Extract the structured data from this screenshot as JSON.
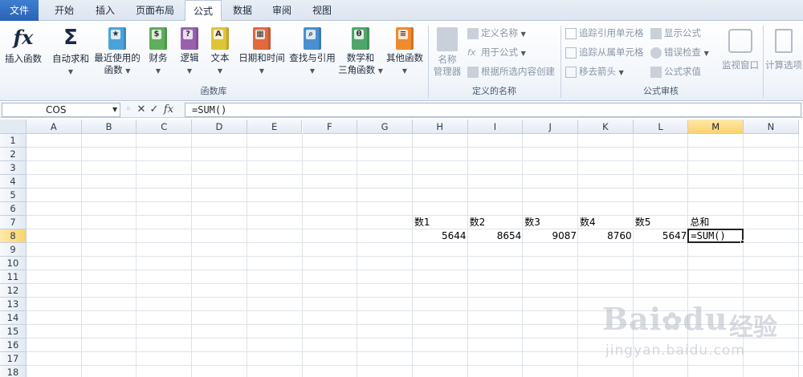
{
  "tabs": [
    "文件",
    "开始",
    "插入",
    "页面布局",
    "公式",
    "数据",
    "审阅",
    "视图"
  ],
  "active_tab": "公式",
  "ribbon": {
    "function_library": {
      "label": "函数库",
      "insert_function": "插入函数",
      "autosum": "自动求和",
      "recent_line1": "最近使用的",
      "recent_line2": "函数",
      "financial": "财务",
      "logical": "逻辑",
      "text": "文本",
      "datetime": "日期和时间",
      "lookup": "查找与引用",
      "math_line1": "数学和",
      "math_line2": "三角函数",
      "more": "其他函数"
    },
    "defined_names": {
      "label": "定义的名称",
      "name_manager_line1": "名称",
      "name_manager_line2": "管理器",
      "define_name": "定义名称",
      "use_in_formula": "用于公式",
      "create_from_selection": "根据所选内容创建"
    },
    "formula_auditing": {
      "label": "公式审核",
      "trace_precedents": "追踪引用单元格",
      "trace_dependents": "追踪从属单元格",
      "remove_arrows": "移去箭头",
      "show_formulas": "显示公式",
      "error_checking": "错误检查",
      "evaluate_formula": "公式求值",
      "watch_window": "监视窗口"
    },
    "calculation": {
      "options": "计算选项"
    }
  },
  "formula_bar": {
    "name_box": "COS",
    "cancel": "✕",
    "enter": "✓",
    "fx": "fx",
    "formula": "=SUM()"
  },
  "sheet": {
    "columns": [
      "A",
      "B",
      "C",
      "D",
      "E",
      "F",
      "G",
      "H",
      "I",
      "J",
      "K",
      "L",
      "M",
      "N"
    ],
    "rows": [
      "1",
      "2",
      "3",
      "4",
      "5",
      "6",
      "7",
      "8",
      "9",
      "10",
      "11",
      "12",
      "13",
      "14",
      "15",
      "16",
      "17",
      "18"
    ],
    "selected_column": "M",
    "selected_row": "8",
    "headers": [
      "数1",
      "数2",
      "数3",
      "数4",
      "数5",
      "总和"
    ],
    "values": [
      "5644",
      "8654",
      "9087",
      "8760",
      "5647"
    ],
    "active_cell_text": "=SUM()"
  },
  "watermark": {
    "brand": "Bai",
    "brand2": "du",
    "cn": "经验",
    "url": "jingyan.baidu.com"
  }
}
